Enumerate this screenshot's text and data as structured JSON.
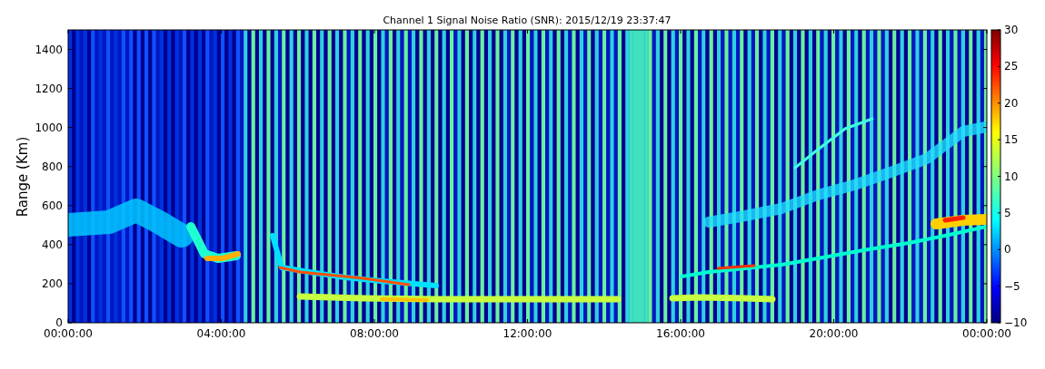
{
  "title": "Channel 1 Signal Noise Ratio (SNR): 2015/12/19 23:37:47",
  "ylabel": "Range (Km)",
  "yticks": [
    "1400",
    "1200",
    "1000",
    "800",
    "600",
    "400",
    "200",
    "0"
  ],
  "xticks": [
    "00:00:00",
    "04:00:00",
    "08:00:00",
    "12:00:00",
    "16:00:00",
    "20:00:00",
    "00:00:00"
  ],
  "colorbar_ticks": [
    "30",
    "25",
    "20",
    "15",
    "10",
    "5",
    "0",
    "−5",
    "−10"
  ]
}
